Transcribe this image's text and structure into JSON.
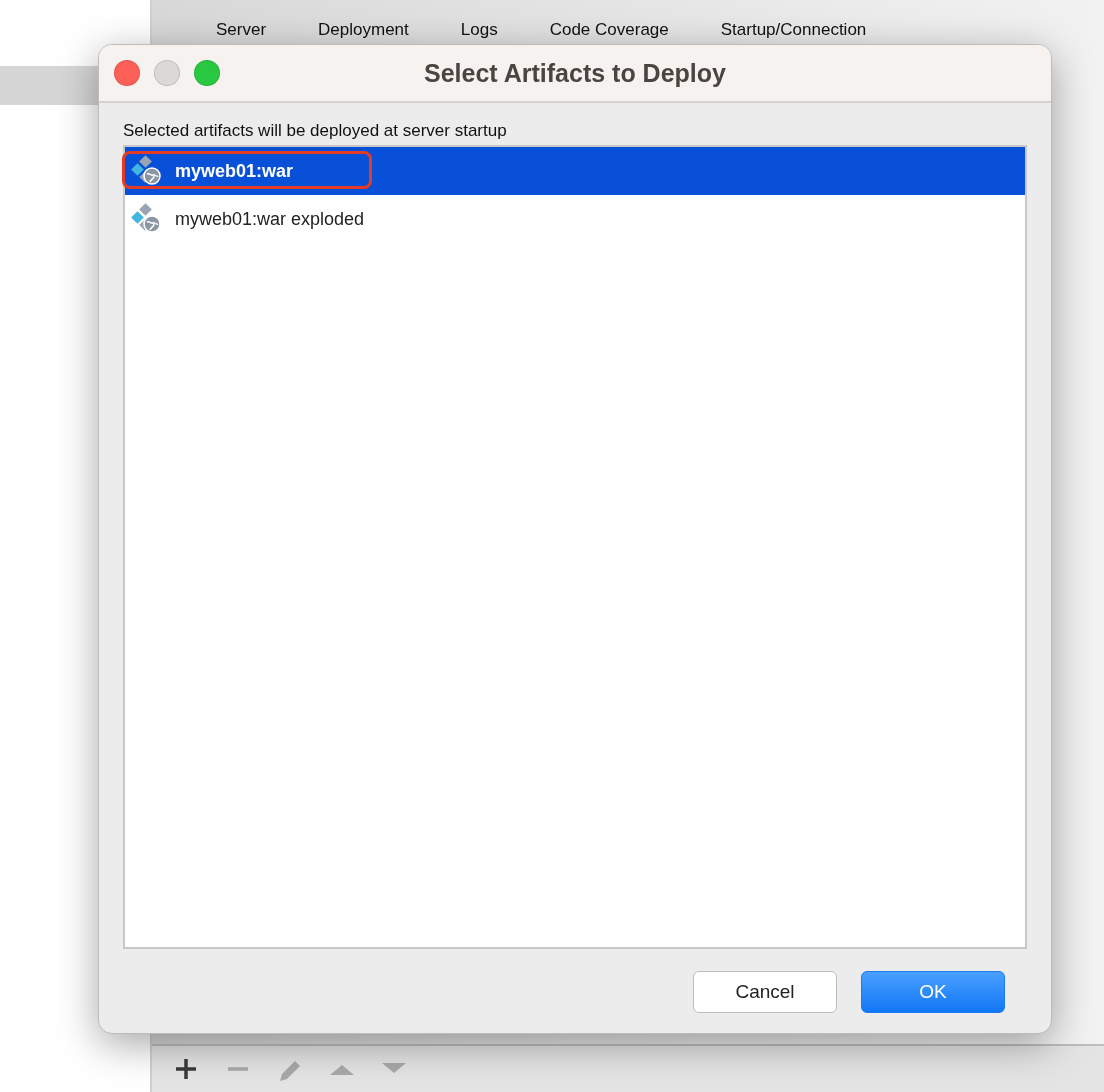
{
  "background": {
    "tabs": [
      {
        "label": "Server"
      },
      {
        "label": "Deployment"
      },
      {
        "label": "Logs"
      },
      {
        "label": "Code Coverage"
      },
      {
        "label": "Startup/Connection"
      }
    ],
    "toolbar": [
      {
        "kind": "add",
        "disabled": false
      },
      {
        "kind": "remove",
        "disabled": true
      },
      {
        "kind": "edit",
        "disabled": true
      },
      {
        "kind": "up",
        "disabled": true
      },
      {
        "kind": "down",
        "disabled": true
      }
    ]
  },
  "dialog": {
    "title": "Select Artifacts to Deploy",
    "hint": "Selected artifacts will be deployed at server startup",
    "artifacts": [
      {
        "label": "myweb01:war",
        "selected": true,
        "highlighted": true
      },
      {
        "label": "myweb01:war exploded",
        "selected": false,
        "highlighted": false
      }
    ],
    "buttons": [
      {
        "label": "Cancel",
        "kind": "secondary"
      },
      {
        "label": "OK",
        "kind": "primary"
      }
    ]
  }
}
